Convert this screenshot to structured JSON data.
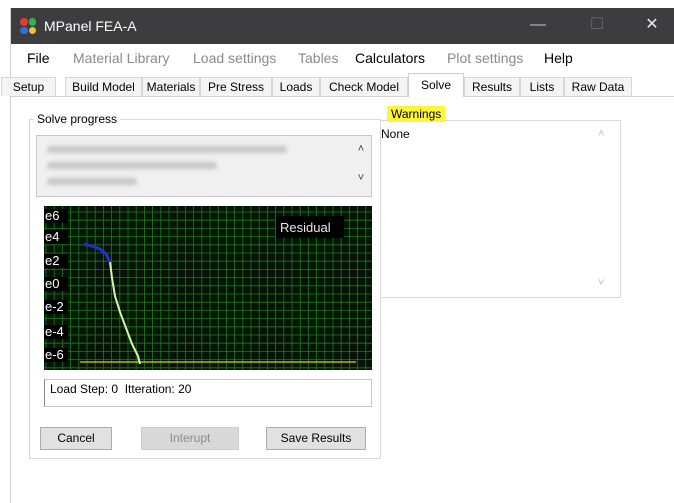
{
  "window": {
    "title": "MPanel FEA-A",
    "controls": {
      "minimize": "—",
      "maximize": "☐",
      "close": "✕"
    }
  },
  "menu": [
    {
      "label": "File",
      "enabled": true
    },
    {
      "label": "Material Library",
      "enabled": false
    },
    {
      "label": "Load settings",
      "enabled": false
    },
    {
      "label": "Tables",
      "enabled": false
    },
    {
      "label": "Calculators",
      "enabled": true
    },
    {
      "label": "Plot settings",
      "enabled": false
    },
    {
      "label": "Help",
      "enabled": true
    }
  ],
  "tabs": [
    {
      "label": "Setup",
      "active": false
    },
    {
      "label": "Build Model",
      "active": false
    },
    {
      "label": "Materials",
      "active": false
    },
    {
      "label": "Pre Stress",
      "active": false
    },
    {
      "label": "Loads",
      "active": false
    },
    {
      "label": "Check Model",
      "active": false
    },
    {
      "label": "Solve",
      "active": true
    },
    {
      "label": "Results",
      "active": false
    },
    {
      "label": "Lists",
      "active": false
    },
    {
      "label": "Raw Data",
      "active": false
    }
  ],
  "solve_progress": {
    "label": "Solve progress",
    "plot": {
      "title": "Residual",
      "ylabels": [
        "e6",
        "e4",
        "e2",
        "e0",
        "e-2",
        "e-4",
        "e-6"
      ],
      "colors": {
        "background": "#051405",
        "grid": "#1f7a1f",
        "early": "#1f2fd0",
        "late": "#d8f5b0",
        "target": "#b7b700"
      }
    },
    "status": "Load Step: 0  Itteration: 20"
  },
  "warnings": {
    "label": "Warnings",
    "items": [
      "None"
    ],
    "highlight_color": "#fff43c"
  },
  "buttons": {
    "cancel": "Cancel",
    "interrupt": "Interupt",
    "save": "Save Results"
  }
}
